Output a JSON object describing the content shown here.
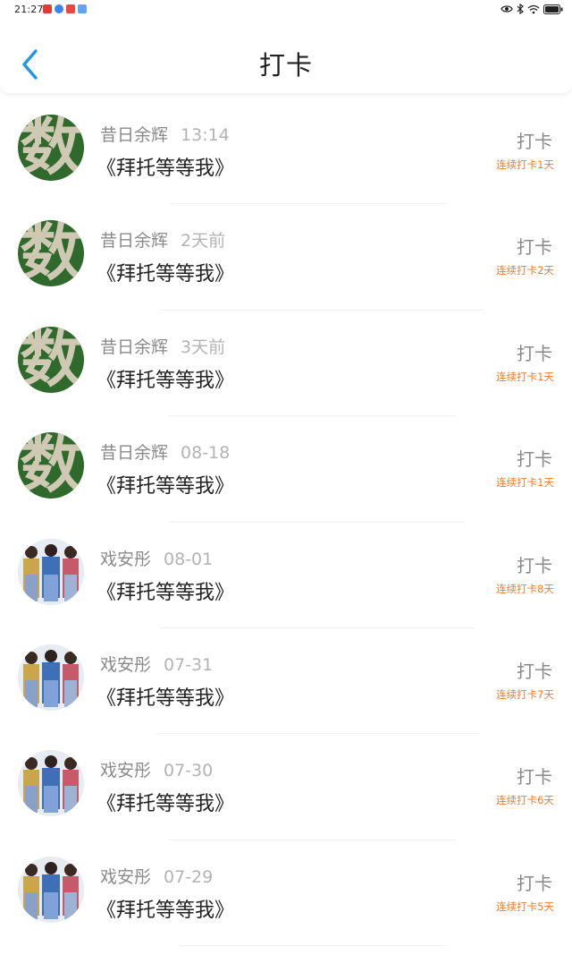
{
  "status_bar": {
    "time": "21:27",
    "notifications": [
      "red-app-icon",
      "blue-app-icon",
      "red-app-icon",
      "blue-app-icon"
    ],
    "icons": [
      "eye-icon",
      "bluetooth-icon",
      "wifi-icon",
      "battery-icon"
    ]
  },
  "header": {
    "title": "打卡",
    "back_icon": "chevron-left-icon"
  },
  "colors": {
    "accent_blue": "#2196e8",
    "streak_orange": "#f07a2a",
    "name_gray": "#8a8a8a",
    "time_gray": "#b3b3b3",
    "avatar_green": "#2f6a2c"
  },
  "list": [
    {
      "avatar_type": "text",
      "avatar_char": "数",
      "name": "昔日余辉",
      "time": "13:14",
      "book": "《拜托等等我》",
      "action": "打卡",
      "streak": "连续打卡1天"
    },
    {
      "avatar_type": "text",
      "avatar_char": "数",
      "name": "昔日余辉",
      "time": "2天前",
      "book": "《拜托等等我》",
      "action": "打卡",
      "streak": "连续打卡2天"
    },
    {
      "avatar_type": "text",
      "avatar_char": "数",
      "name": "昔日余辉",
      "time": "3天前",
      "book": "《拜托等等我》",
      "action": "打卡",
      "streak": "连续打卡1天"
    },
    {
      "avatar_type": "text",
      "avatar_char": "数",
      "name": "昔日余辉",
      "time": "08-18",
      "book": "《拜托等等我》",
      "action": "打卡",
      "streak": "连续打卡1天"
    },
    {
      "avatar_type": "photo",
      "name": "戏安彤",
      "time": "08-01",
      "book": "《拜托等等我》",
      "action": "打卡",
      "streak": "连续打卡8天"
    },
    {
      "avatar_type": "photo",
      "name": "戏安彤",
      "time": "07-31",
      "book": "《拜托等等我》",
      "action": "打卡",
      "streak": "连续打卡7天"
    },
    {
      "avatar_type": "photo",
      "name": "戏安彤",
      "time": "07-30",
      "book": "《拜托等等我》",
      "action": "打卡",
      "streak": "连续打卡6天"
    },
    {
      "avatar_type": "photo",
      "name": "戏安彤",
      "time": "07-29",
      "book": "《拜托等等我》",
      "action": "打卡",
      "streak": "连续打卡5天"
    }
  ]
}
